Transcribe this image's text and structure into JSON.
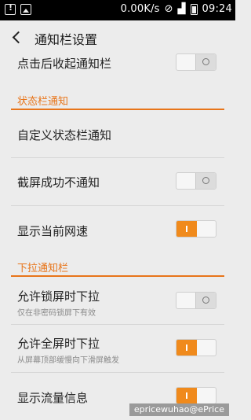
{
  "status_bar": {
    "net_speed": "0.00K/s",
    "time": "09:24",
    "icons": [
      "warning-icon",
      "image-icon",
      "mute-icon",
      "signal-icon",
      "battery-icon"
    ]
  },
  "header": {
    "title": "通知栏设置",
    "back_icon": "back-arrow-icon"
  },
  "rows_top": {
    "collapse_after_click": {
      "label": "点击后收起通知栏",
      "toggle": false
    }
  },
  "section_status_bar": {
    "title": "状态栏通知",
    "custom_notify": {
      "label": "自定义状态栏通知"
    },
    "screenshot_no_notify": {
      "label": "截屏成功不通知",
      "toggle": false
    },
    "show_net_speed": {
      "label": "显示当前网速",
      "toggle": true
    }
  },
  "section_pulldown": {
    "title": "下拉通知栏",
    "allow_lockscreen": {
      "label": "允许锁屏时下拉",
      "sub": "仅在非密码锁屏下有效",
      "toggle": false
    },
    "allow_fullscreen": {
      "label": "允许全屏时下拉",
      "sub": "从屏幕顶部缓慢向下滑屏触发",
      "toggle": true
    },
    "show_traffic": {
      "label": "显示流量信息",
      "toggle": true
    }
  },
  "watermark": "epricewuhao@ePrice",
  "colors": {
    "accent": "#e8751a",
    "toggle_on": "#f08a1c",
    "background": "#ececec"
  }
}
